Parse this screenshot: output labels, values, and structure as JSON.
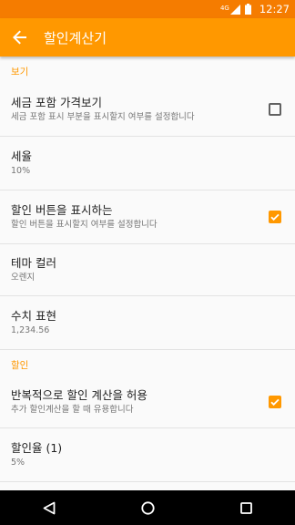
{
  "status_bar": {
    "network": "4G",
    "time": "12:27"
  },
  "app_bar": {
    "title": "할인계산기",
    "back_icon": "arrow-left-icon"
  },
  "accent_color": "#ff9800",
  "sections": {
    "view": {
      "header": "보기",
      "tax_included": {
        "title": "세금 포함 가격보기",
        "summary": "세금 포함 표시 부분을 표시할지 여부를 설정합니다",
        "checked": false
      },
      "tax_rate": {
        "title": "세율",
        "summary": "10%"
      },
      "show_discount_buttons": {
        "title": "할인 버튼을 표시하는",
        "summary": "할인 버튼을 표시할지 여부를 설정합니다",
        "checked": true
      },
      "theme_color": {
        "title": "테마 컬러",
        "summary": "오렌지"
      },
      "number_format": {
        "title": "수치 표현",
        "summary": "1,234.56"
      }
    },
    "discount": {
      "header": "할인",
      "repeat_discount": {
        "title": "반복적으로 할인 계산을 허용",
        "summary": "추가 할인계산을 할 때 유용합니다",
        "checked": true
      },
      "discount_rate_1": {
        "title": "할인율 (1)",
        "summary": "5%"
      }
    }
  }
}
